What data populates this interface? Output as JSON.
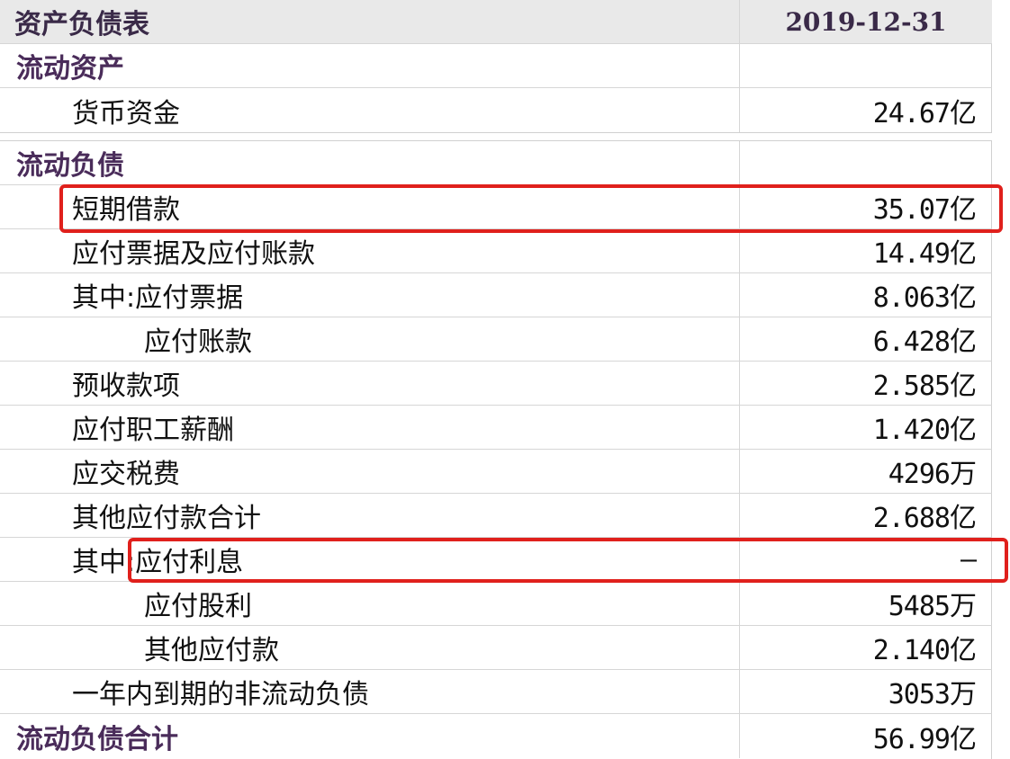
{
  "table": {
    "title": "资产负债表",
    "date": "2019-12-31",
    "top_rows": [
      {
        "label": "流动资产",
        "value": ""
      },
      {
        "label": "货币资金",
        "value": "24.67亿"
      }
    ],
    "rows": [
      {
        "label": "流动负债",
        "value": ""
      },
      {
        "label": "短期借款",
        "value": "35.07亿"
      },
      {
        "label": "应付票据及应付账款",
        "value": "14.49亿"
      },
      {
        "label": "其中:应付票据",
        "value": "8.063亿"
      },
      {
        "label": "应付账款",
        "value": "6.428亿"
      },
      {
        "label": "预收款项",
        "value": "2.585亿"
      },
      {
        "label": "应付职工薪酬",
        "value": "1.420亿"
      },
      {
        "label": "应交税费",
        "value": "4296万"
      },
      {
        "label": "其他应付款合计",
        "value": "2.688亿"
      },
      {
        "label": "其中:应付利息",
        "value": "—"
      },
      {
        "label": "应付股利",
        "value": "5485万"
      },
      {
        "label": "其他应付款",
        "value": "2.140亿"
      },
      {
        "label": "一年内到期的非流动负债",
        "value": "3053万"
      },
      {
        "label": "流动负债合计",
        "value": "56.99亿"
      }
    ]
  },
  "colors": {
    "highlight": "#e0201c",
    "section_text": "#4a2c5a",
    "header_bg": "#e9e9e9"
  }
}
